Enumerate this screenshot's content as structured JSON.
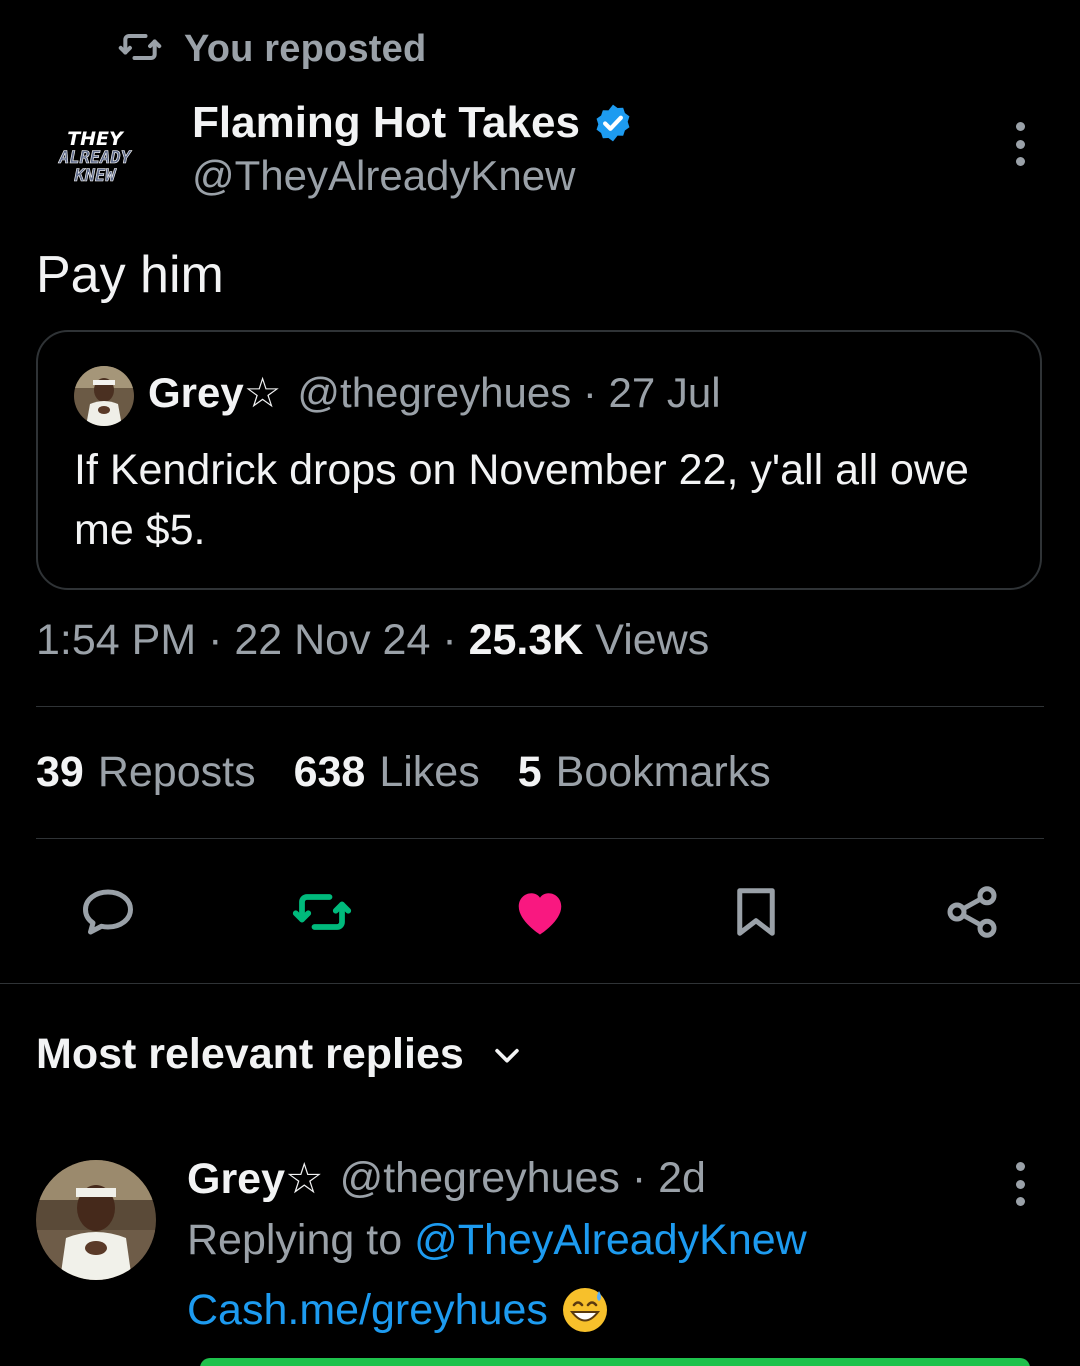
{
  "repost_banner": {
    "label": "You reposted",
    "icon": "repost-icon"
  },
  "author": {
    "name": "Flaming Hot Takes",
    "handle": "@TheyAlreadyKnew",
    "verified": true,
    "avatar_text": [
      "THEY",
      "ALREADY",
      "KNEW"
    ]
  },
  "tweet": {
    "text": "Pay him"
  },
  "quote": {
    "name": "Grey☆",
    "meta": "@thegreyhues · 27 Jul",
    "text": "If Kendrick drops on November 22, y'all all owe me $5."
  },
  "meta": {
    "time_date": "1:54 PM · 22 Nov 24 ·",
    "views_count": "25.3K",
    "views_label": "Views"
  },
  "stats": {
    "reposts_count": "39",
    "reposts_label": "Reposts",
    "likes_count": "638",
    "likes_label": "Likes",
    "bookmarks_count": "5",
    "bookmarks_label": "Bookmarks"
  },
  "actions": [
    {
      "name": "reply",
      "icon": "comment-icon",
      "color": "#9aa1a8"
    },
    {
      "name": "repost",
      "icon": "repost-icon",
      "color": "#00ba7c"
    },
    {
      "name": "like",
      "icon": "heart-icon",
      "color": "#f91880"
    },
    {
      "name": "bookmark",
      "icon": "bookmark-icon",
      "color": "#9aa1a8"
    },
    {
      "name": "share",
      "icon": "share-icon",
      "color": "#9aa1a8"
    }
  ],
  "replies": {
    "header": "Most relevant replies",
    "items": [
      {
        "name": "Grey☆",
        "meta": "@thegreyhues · 2d",
        "replying_prefix": "Replying to",
        "replying_handle": "@TheyAlreadyKnew",
        "text": "Cash.me/greyhues",
        "emoji": "😅"
      }
    ]
  },
  "colors": {
    "background": "#000000",
    "text_primary": "#f2f3f4",
    "text_secondary": "#9aa1a8",
    "link": "#1d9bf0",
    "border": "#2f3336",
    "like": "#f91880",
    "repost": "#00ba7c",
    "verified": "#1d9bf0"
  }
}
